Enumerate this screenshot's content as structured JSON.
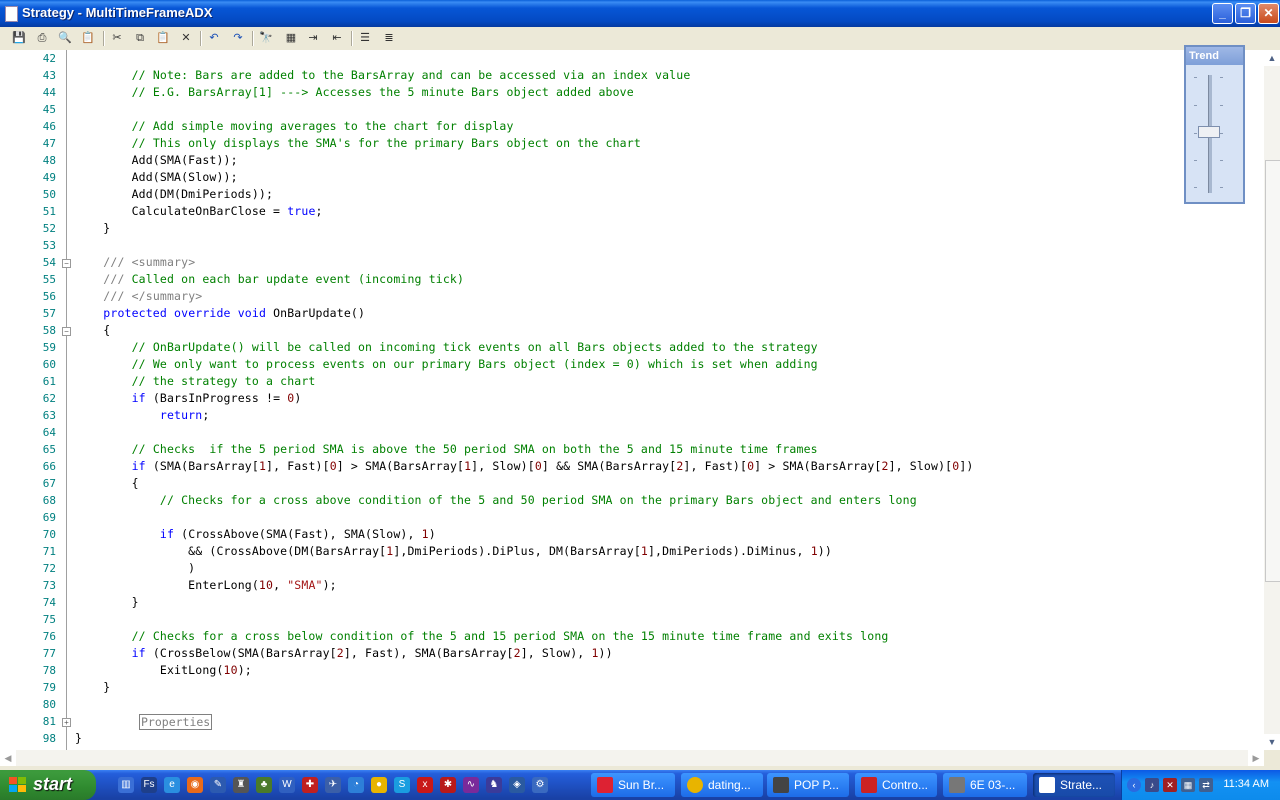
{
  "window": {
    "title": "Strategy - MultiTimeFrameADX"
  },
  "title_buttons": {
    "minimize": "_",
    "maximize": "❐",
    "close": "✕"
  },
  "toolbar": [
    "save-icon",
    "print-icon",
    "print-preview-icon",
    "page-setup-icon",
    "cut-icon",
    "copy-icon",
    "paste-icon",
    "delete-icon",
    "undo-icon",
    "redo-icon",
    "find-icon",
    "replace-icon",
    "indent-icon",
    "outdent-icon",
    "comment-icon",
    "uncomment-icon"
  ],
  "trend": {
    "label": "Trend",
    "level": 0.5
  },
  "editor": {
    "line_numbers": [
      "42",
      "43",
      "44",
      "45",
      "46",
      "47",
      "48",
      "49",
      "50",
      "51",
      "52",
      "53",
      "54",
      "55",
      "56",
      "57",
      "58",
      "59",
      "60",
      "61",
      "62",
      "63",
      "64",
      "65",
      "66",
      "67",
      "68",
      "69",
      "70",
      "71",
      "72",
      "73",
      "74",
      "75",
      "76",
      "77",
      "78",
      "79",
      "80",
      "81",
      "98"
    ],
    "lines": [
      "",
      "        // Note: Bars are added to the BarsArray and can be accessed via an index value",
      "        // E.G. BarsArray[1] ---> Accesses the 5 minute Bars object added above",
      "",
      "        // Add simple moving averages to the chart for display",
      "        // This only displays the SMA's for the primary Bars object on the chart",
      "        Add(SMA(Fast));",
      "        Add(SMA(Slow));",
      "        Add(DM(DmiPeriods));",
      "        CalculateOnBarClose = true;",
      "    }",
      "",
      "    /// <summary>",
      "    /// Called on each bar update event (incoming tick)",
      "    /// </summary>",
      "    protected override void OnBarUpdate()",
      "    {",
      "        // OnBarUpdate() will be called on incoming tick events on all Bars objects added to the strategy",
      "        // We only want to process events on our primary Bars object (index = 0) which is set when adding",
      "        // the strategy to a chart",
      "        if (BarsInProgress != 0)",
      "            return;",
      "",
      "        // Checks  if the 5 period SMA is above the 50 period SMA on both the 5 and 15 minute time frames",
      "        if (SMA(BarsArray[1], Fast)[0] > SMA(BarsArray[1], Slow)[0] && SMA(BarsArray[2], Fast)[0] > SMA(BarsArray[2], Slow)[0])",
      "        {",
      "            // Checks for a cross above condition of the 5 and 50 period SMA on the primary Bars object and enters long",
      "",
      "            if (CrossAbove(SMA(Fast), SMA(Slow), 1)",
      "                && (CrossAbove(DM(BarsArray[1],DmiPeriods).DiPlus, DM(BarsArray[1],DmiPeriods).DiMinus, 1))",
      "                )",
      "                EnterLong(10, \"SMA\");",
      "        }",
      "",
      "        // Checks for a cross below condition of the 5 and 15 period SMA on the 15 minute time frame and exits long",
      "        if (CrossBelow(SMA(BarsArray[2], Fast), SMA(BarsArray[2], Slow), 1))",
      "            ExitLong(10);",
      "    }",
      "",
      "    Properties",
      "}"
    ]
  },
  "taskbar": {
    "start_label": "start",
    "tasks": [
      {
        "label": "Sun Br...",
        "icon": "xm-icon",
        "color": "#d23"
      },
      {
        "label": "dating...",
        "icon": "chrome-icon",
        "color": "#e8b400"
      },
      {
        "label": "POP P...",
        "icon": "pop-icon",
        "color": "#444"
      },
      {
        "label": "Contro...",
        "icon": "ninja-icon",
        "color": "#c22"
      },
      {
        "label": "6E 03-...",
        "icon": "chart-icon",
        "color": "#777"
      },
      {
        "label": "Strate...",
        "icon": "document-icon",
        "color": "#fff"
      }
    ],
    "clock": "11:34 AM"
  }
}
